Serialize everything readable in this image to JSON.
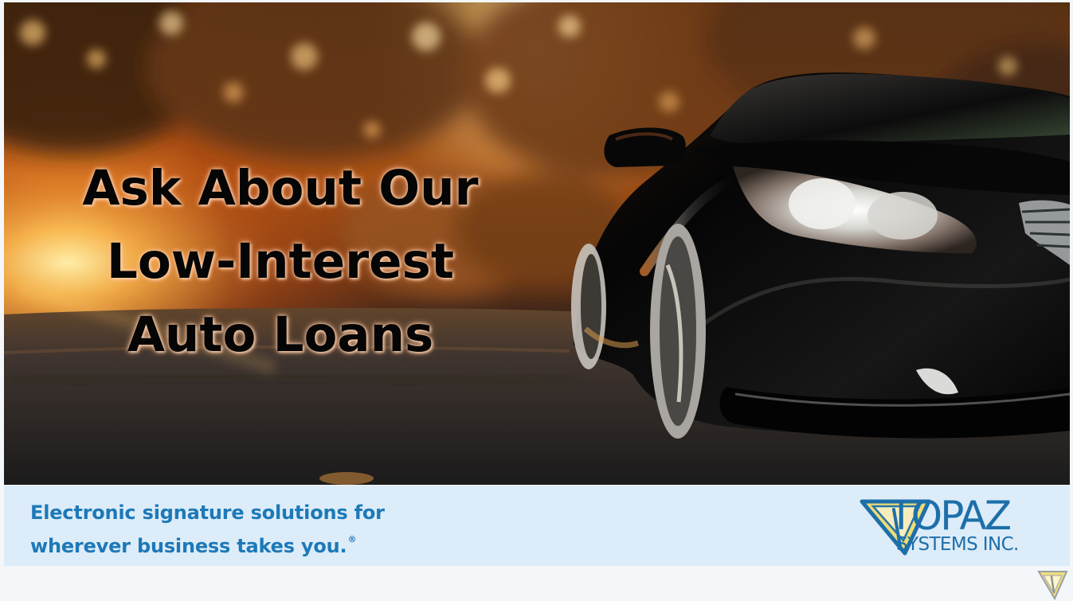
{
  "ad": {
    "headline_lines": [
      "Ask About Our",
      "Low-Interest",
      "Auto Loans"
    ],
    "tagline_lines": [
      "Electronic signature solutions for",
      "wherever business takes you."
    ],
    "registered_mark": "®",
    "logo": {
      "main": "TOPAZ",
      "sub": "SYSTEMS INC."
    },
    "image_subject": "black-sports-car-on-sunset-road",
    "icons": {
      "logo_mark": "topaz-pen-triangle-icon",
      "corner_mark": "topaz-small-badge-icon"
    }
  },
  "colors": {
    "headline": "#050505",
    "tagline": "#1d79b8",
    "logo_blue": "#1d6fa9",
    "logo_gold": "#e8cf5e",
    "footer_bg": "#dcecf9",
    "page_bg": "#f3f7fa"
  }
}
